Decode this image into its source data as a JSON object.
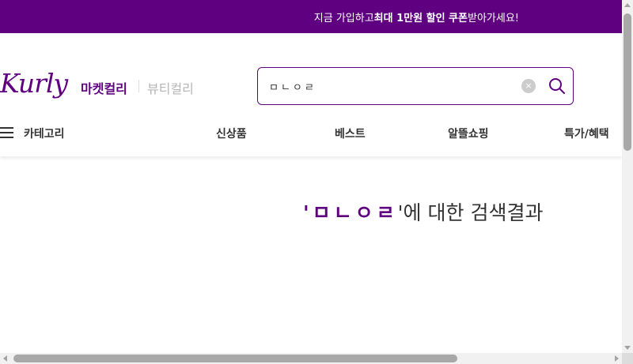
{
  "promo": {
    "prefix": "지금 가입하고 ",
    "highlight": "최대 1만원 할인 쿠폰",
    "suffix": " 받아가세요!"
  },
  "header": {
    "logo": "Kurly",
    "tabs": {
      "market": "마켓컬리",
      "beauty": "뷰티컬리"
    },
    "search": {
      "value": "ㅁㄴㅇㄹ",
      "clear_icon": "×"
    }
  },
  "nav": {
    "category": "카테고리",
    "items": [
      "신상품",
      "베스트",
      "알뜰쇼핑",
      "특가/혜택"
    ]
  },
  "results": {
    "open_quote": "'",
    "keyword": "ㅁㄴㅇㄹ",
    "suffix": "'에 대한 검색결과"
  },
  "colors": {
    "brand": "#5f0080"
  }
}
